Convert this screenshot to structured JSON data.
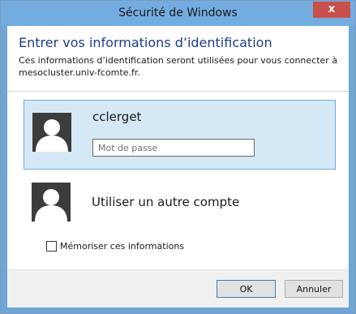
{
  "window": {
    "title": "Sécurité de Windows",
    "close_glyph": "x"
  },
  "dialog": {
    "heading": "Entrer vos informations d’identification",
    "description": "Ces informations d’identification seront utilisées pour vous connecter à mesocluster.univ-fcomte.fr."
  },
  "accounts": {
    "selected": {
      "username": "cclerget",
      "password_placeholder": "Mot de passe",
      "password_value": ""
    },
    "other": {
      "label": "Utiliser un autre compte"
    }
  },
  "remember": {
    "label": "Mémoriser ces informations",
    "checked": false
  },
  "buttons": {
    "ok": "OK",
    "cancel": "Annuler"
  },
  "colors": {
    "titlebar": "#74acdf",
    "close": "#c7504b",
    "heading": "#1c3d8c",
    "selected_tile": "#d5e8f6"
  }
}
